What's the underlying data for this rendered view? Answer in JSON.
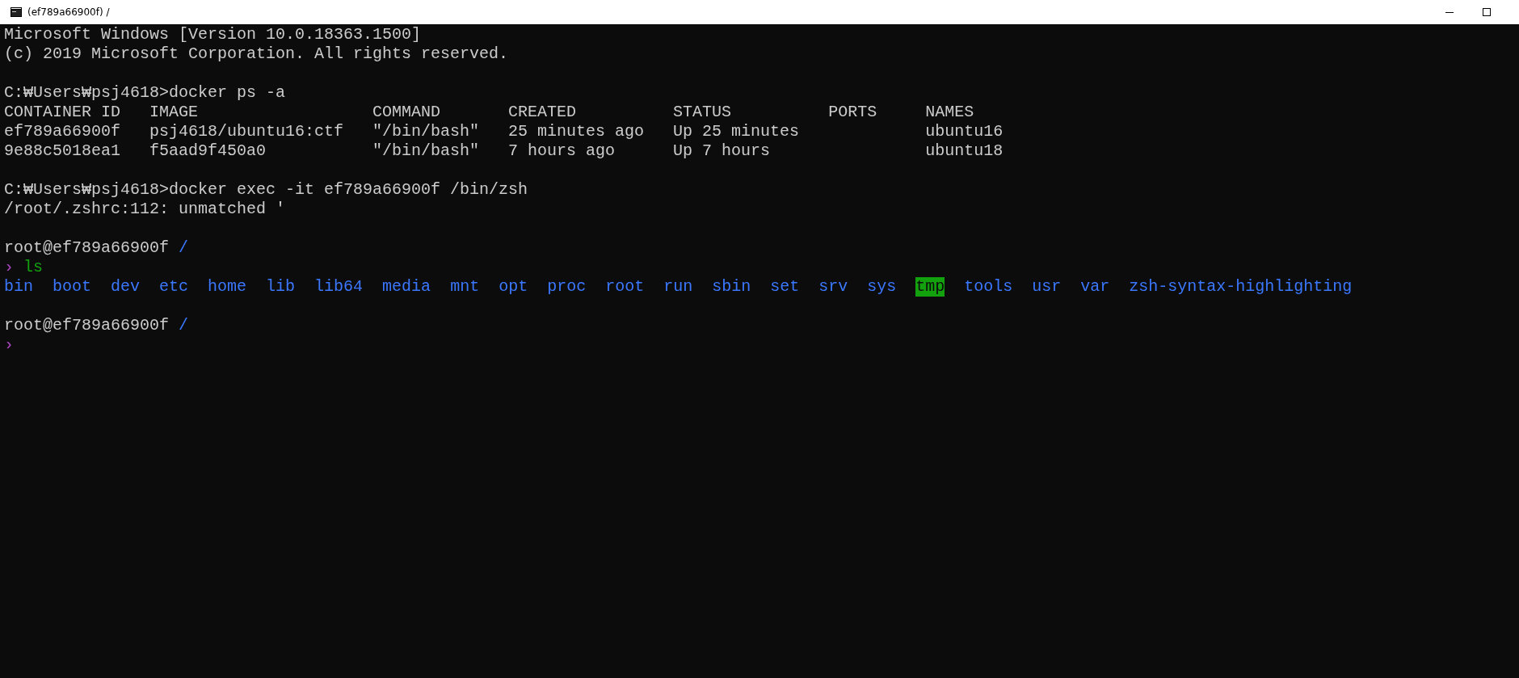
{
  "window": {
    "title": "(ef789a66900f) /"
  },
  "lines": [
    {
      "kind": "text",
      "text": "Microsoft Windows [Version 10.0.18363.1500]"
    },
    {
      "kind": "text",
      "text": "(c) 2019 Microsoft Corporation. All rights reserved."
    },
    {
      "kind": "blank"
    },
    {
      "kind": "text",
      "text": "C:₩Users₩psj4618>docker ps -a"
    },
    {
      "kind": "table",
      "columns": [
        "CONTAINER ID",
        "IMAGE",
        "COMMAND",
        "CREATED",
        "STATUS",
        "PORTS",
        "NAMES"
      ],
      "rows": [
        {
          "container_id": "ef789a66900f",
          "image": "psj4618/ubuntu16:ctf",
          "command": "\"/bin/bash\"",
          "created": "25 minutes ago",
          "status": "Up 25 minutes",
          "names": "ubuntu16"
        },
        {
          "container_id": "9e88c5018ea1",
          "image": "f5aad9f450a0",
          "command": "\"/bin/bash\"",
          "created": "7 hours ago",
          "status": "Up 7 hours",
          "names": "ubuntu18"
        }
      ]
    },
    {
      "kind": "blank"
    },
    {
      "kind": "text",
      "text": "C:₩Users₩psj4618>docker exec -it ef789a66900f /bin/zsh"
    },
    {
      "kind": "text",
      "text": "/root/.zshrc:112: unmatched '"
    },
    {
      "kind": "blank"
    },
    {
      "kind": "prompt",
      "host": "root@ef789a66900f",
      "path": "/"
    },
    {
      "kind": "input",
      "arrow": "›",
      "command": "ls"
    },
    {
      "kind": "listing",
      "entries": [
        {
          "name": "bin",
          "highlighted": false
        },
        {
          "name": "boot",
          "highlighted": false
        },
        {
          "name": "dev",
          "highlighted": false
        },
        {
          "name": "etc",
          "highlighted": false
        },
        {
          "name": "home",
          "highlighted": false
        },
        {
          "name": "lib",
          "highlighted": false
        },
        {
          "name": "lib64",
          "highlighted": false
        },
        {
          "name": "media",
          "highlighted": false
        },
        {
          "name": "mnt",
          "highlighted": false
        },
        {
          "name": "opt",
          "highlighted": false
        },
        {
          "name": "proc",
          "highlighted": false
        },
        {
          "name": "root",
          "highlighted": false
        },
        {
          "name": "run",
          "highlighted": false
        },
        {
          "name": "sbin",
          "highlighted": false
        },
        {
          "name": "set",
          "highlighted": false
        },
        {
          "name": "srv",
          "highlighted": false
        },
        {
          "name": "sys",
          "highlighted": false
        },
        {
          "name": "tmp",
          "highlighted": true
        },
        {
          "name": "tools",
          "highlighted": false
        },
        {
          "name": "usr",
          "highlighted": false
        },
        {
          "name": "var",
          "highlighted": false
        },
        {
          "name": "zsh-syntax-highlighting",
          "highlighted": false
        }
      ]
    },
    {
      "kind": "blank"
    },
    {
      "kind": "prompt",
      "host": "root@ef789a66900f",
      "path": "/"
    },
    {
      "kind": "input",
      "arrow": "›"
    }
  ]
}
